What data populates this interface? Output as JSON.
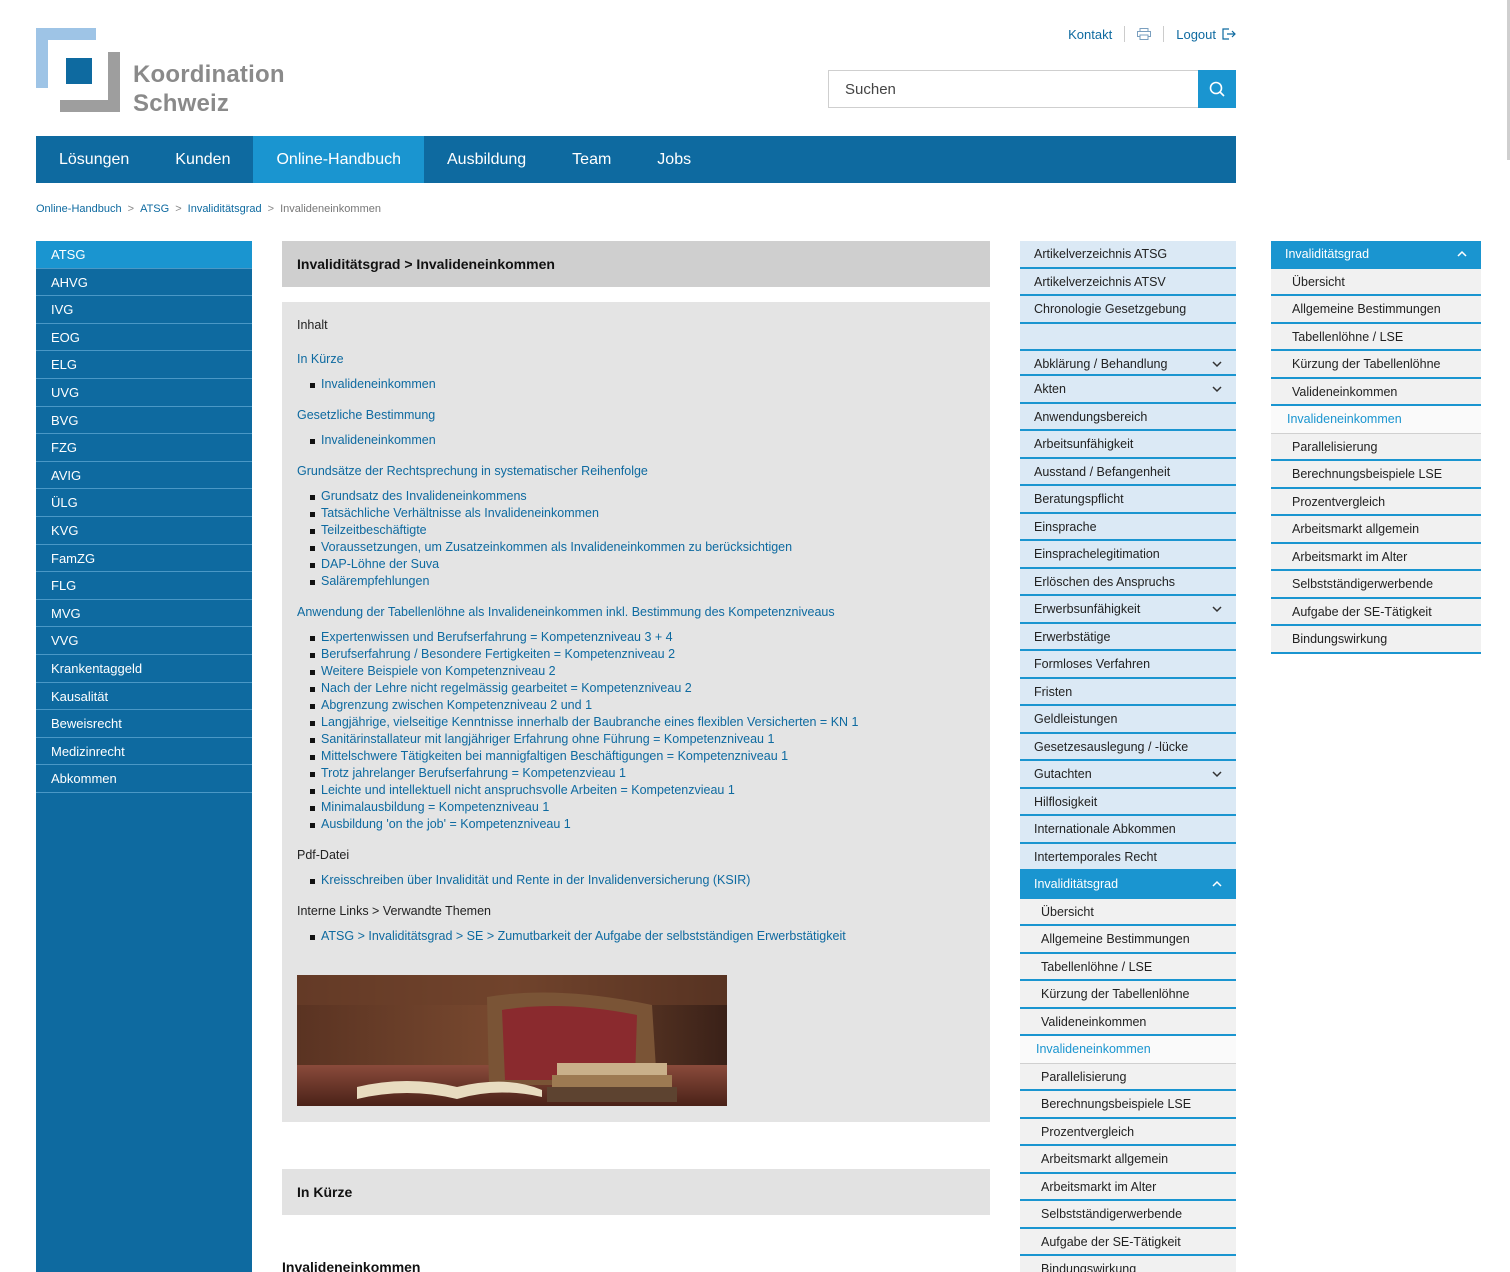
{
  "header": {
    "logo_line1": "Koordination",
    "logo_line2": "Schweiz",
    "contact": "Kontakt",
    "logout": "Logout",
    "search_placeholder": "Suchen"
  },
  "mainnav": [
    "Lösungen",
    "Kunden",
    "Online-Handbuch",
    "Ausbildung",
    "Team",
    "Jobs"
  ],
  "breadcrumb": [
    "Online-Handbuch",
    "ATSG",
    "Invaliditätsgrad",
    "Invalideneinkommen"
  ],
  "leftnav": [
    "ATSG",
    "AHVG",
    "IVG",
    "EOG",
    "ELG",
    "UVG",
    "BVG",
    "FZG",
    "AVIG",
    "ÜLG",
    "KVG",
    "FamZG",
    "FLG",
    "MVG",
    "VVG",
    "Krankentaggeld",
    "Kausalität",
    "Beweisrecht",
    "Medizinrecht",
    "Abkommen"
  ],
  "content": {
    "title": "Invaliditätsgrad > Invalideneinkommen",
    "inhalt": "Inhalt",
    "s1": {
      "title": "In Kürze",
      "items": [
        "Invalideneinkommen"
      ]
    },
    "s2": {
      "title": "Gesetzliche Bestimmung",
      "items": [
        "Invalideneinkommen"
      ]
    },
    "s3": {
      "title": "Grundsätze der Rechtsprechung in systematischer Reihenfolge",
      "items": [
        "Grundsatz des Invalideneinkommens",
        "Tatsächliche Verhältnisse als Invalideneinkommen",
        "Teilzeitbeschäftigte",
        "Voraussetzungen, um Zusatzeinkommen als Invalideneinkommen zu berücksichtigen",
        "DAP-Löhne der Suva",
        "Salärempfehlungen"
      ]
    },
    "s4": {
      "title": "Anwendung der Tabellenlöhne als Invalideneinkommen inkl. Bestimmung des Kompetenzniveaus",
      "items": [
        "Expertenwissen und Berufserfahrung = Kompetenzniveau 3 + 4",
        "Berufserfahrung / Besondere Fertigkeiten = Kompetenzniveau 2",
        "Weitere Beispiele von Kompetenzniveau 2",
        "Nach der Lehre nicht regelmässig gearbeitet = Kompetenzniveau 2",
        "Abgrenzung zwischen Kompetenzniveau 2 und 1",
        "Langjährige, vielseitige Kenntnisse innerhalb der Baubranche eines flexiblen Versicherten = KN 1",
        "Sanitärinstallateur mit langjähriger Erfahrung ohne Führung = Kompetenzniveau 1",
        "Mittelschwere Tätigkeiten bei mannigfaltigen Beschäftigungen = Kompetenzniveau 1",
        "Trotz jahrelanger Berufserfahrung = Kompetenzvieau 1",
        "Leichte und intellektuell nicht anspruchsvolle Arbeiten = Kompetenzvieau 1",
        "Minimalausbildung = Kompetenzniveau 1",
        "Ausbildung 'on the job' = Kompetenzniveau 1"
      ]
    },
    "s5": {
      "title": "Pdf-Datei",
      "items": [
        "Kreisschreiben über Invalidität und Rente in der Invalidenversicherung (KSIR)"
      ]
    },
    "s6": {
      "title": "Interne Links > Verwandte Themen",
      "items": [
        "ATSG > Invaliditätsgrad > SE > Zumutbarkeit der Aufgabe der selbstständigen Erwerbstätigkeit"
      ]
    },
    "kurz_title": "In Kürze",
    "subhead": "Invalideneinkommen"
  },
  "rightnav": {
    "top": [
      "Artikelverzeichnis ATSG",
      "Artikelverzeichnis ATSV",
      "Chronologie Gesetzgebung"
    ],
    "topics": [
      {
        "label": "Abklärung / Behandlung",
        "chevron": true
      },
      {
        "label": "Akten",
        "chevron": true
      },
      {
        "label": "Anwendungsbereich"
      },
      {
        "label": "Arbeitsunfähigkeit"
      },
      {
        "label": "Ausstand / Befangenheit"
      },
      {
        "label": "Beratungspflicht"
      },
      {
        "label": "Einsprache"
      },
      {
        "label": "Einsprachelegitimation"
      },
      {
        "label": "Erlöschen des Anspruchs"
      },
      {
        "label": "Erwerbsunfähigkeit",
        "chevron": true
      },
      {
        "label": "Erwerbstätige"
      },
      {
        "label": "Formloses Verfahren"
      },
      {
        "label": "Fristen"
      },
      {
        "label": "Geldleistungen"
      },
      {
        "label": "Gesetzesauslegung / -lücke"
      },
      {
        "label": "Gutachten",
        "chevron": true
      },
      {
        "label": "Hilflosigkeit"
      },
      {
        "label": "Internationale Abkommen"
      },
      {
        "label": "Intertemporales Recht"
      }
    ],
    "open_head": "Invaliditätsgrad",
    "sub": [
      "Übersicht",
      "Allgemeine Bestimmungen",
      "Tabellenlöhne / LSE",
      "Kürzung der Tabellenlöhne",
      "Valideneinkommen",
      "Invalideneinkommen",
      "Parallelisierung",
      "Berechnungsbeispiele LSE",
      "Prozentvergleich",
      "Arbeitsmarkt allgemein",
      "Arbeitsmarkt im Alter",
      "Selbstständigerwerbende",
      "Aufgabe der SE-Tätigkeit",
      "Bindungswirkung"
    ],
    "current": "Invalideneinkommen"
  },
  "colors": {
    "nav_blue": "#0e6aa0",
    "active_blue": "#1a95d0"
  }
}
